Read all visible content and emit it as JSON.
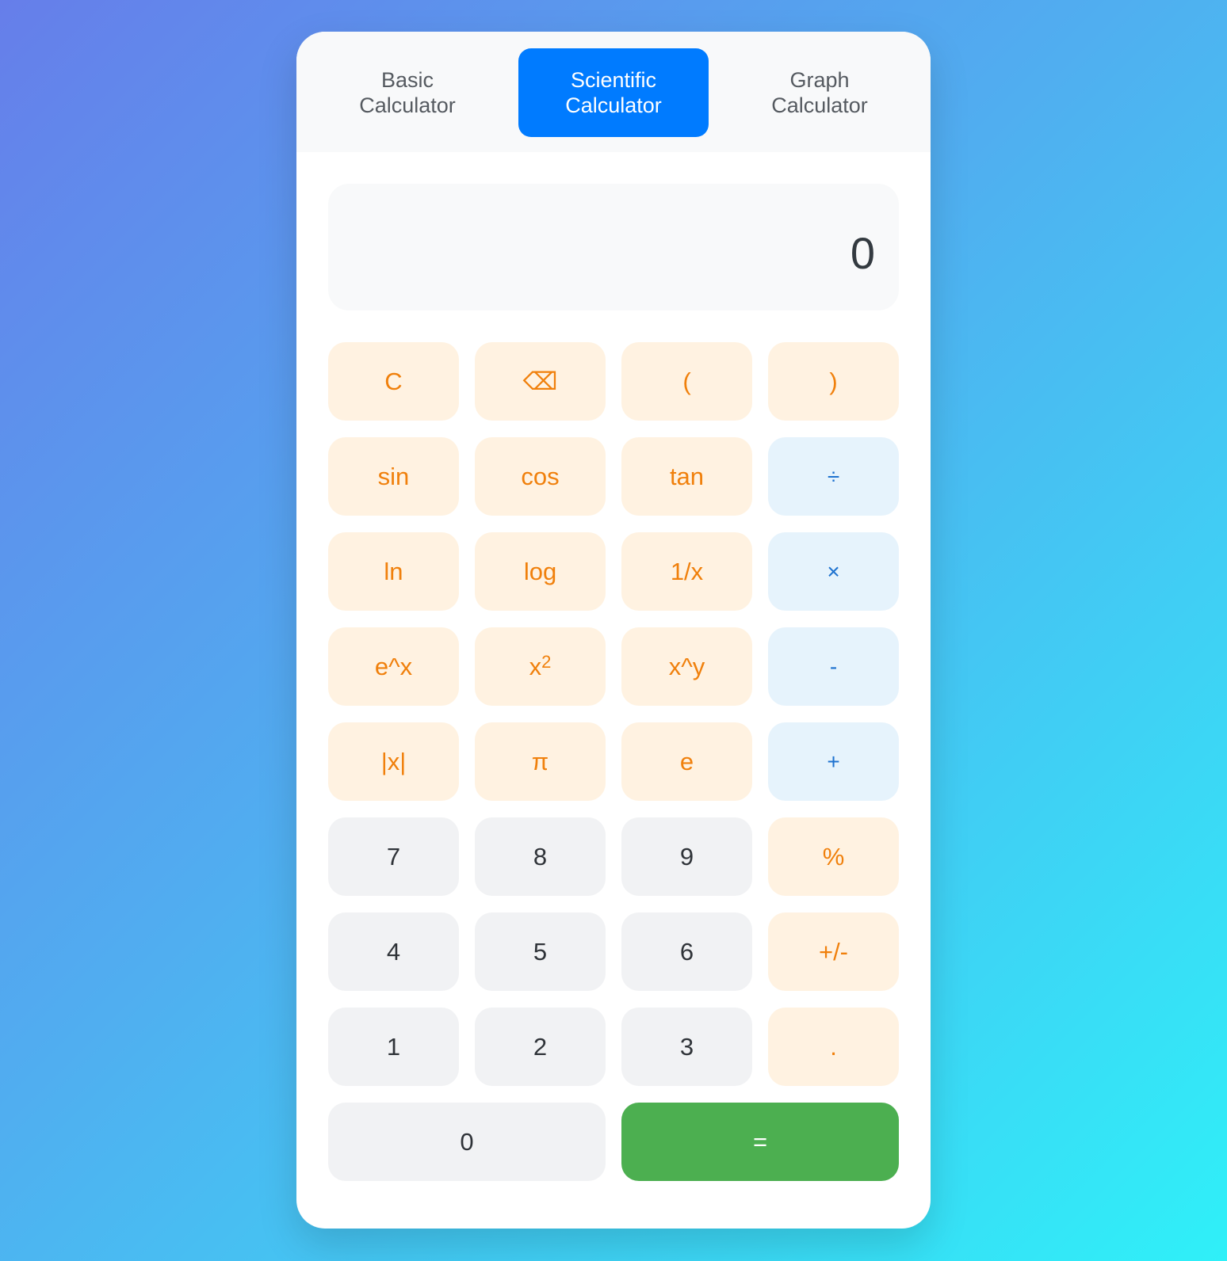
{
  "tabs": [
    {
      "label": "Basic\nCalculator",
      "active": false
    },
    {
      "label": "Scientific\nCalculator",
      "active": true
    },
    {
      "label": "Graph\nCalculator",
      "active": false
    }
  ],
  "display": {
    "value": "0"
  },
  "keys": {
    "clear": "C",
    "backspace": "⌫",
    "paren_open": "(",
    "paren_close": ")",
    "sin": "sin",
    "cos": "cos",
    "tan": "tan",
    "divide": "÷",
    "ln": "ln",
    "log": "log",
    "reciprocal": "1/x",
    "multiply": "×",
    "exp": "e^x",
    "square_base": "x",
    "square_exp": "2",
    "power": "x^y",
    "subtract": "-",
    "abs": "|x|",
    "pi": "π",
    "euler": "e",
    "add": "+",
    "seven": "7",
    "eight": "8",
    "nine": "9",
    "percent": "%",
    "four": "4",
    "five": "5",
    "six": "6",
    "negate": "+/-",
    "one": "1",
    "two": "2",
    "three": "3",
    "decimal": ".",
    "zero": "0",
    "equals": "="
  },
  "colors": {
    "active_tab": "#007bff",
    "function_key_bg": "#fff2e1",
    "function_key_text": "#f0800c",
    "operator_key_bg": "#e6f3fc",
    "operator_key_text": "#1e72cf",
    "number_key_bg": "#f1f2f4",
    "equals_key_bg": "#4caf50"
  }
}
